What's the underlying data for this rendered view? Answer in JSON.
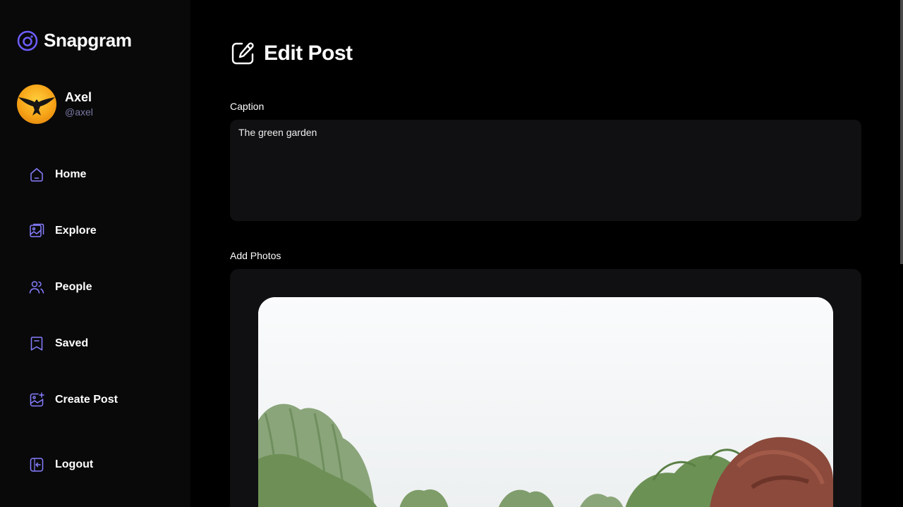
{
  "app": {
    "name": "Snapgram"
  },
  "user": {
    "name": "Axel",
    "handle": "@axel"
  },
  "nav": [
    {
      "label": "Home",
      "icon": "home-icon"
    },
    {
      "label": "Explore",
      "icon": "explore-icon"
    },
    {
      "label": "People",
      "icon": "people-icon"
    },
    {
      "label": "Saved",
      "icon": "bookmark-icon"
    },
    {
      "label": "Create Post",
      "icon": "create-post-icon"
    }
  ],
  "logout": {
    "label": "Logout",
    "icon": "logout-icon"
  },
  "page": {
    "title": "Edit Post",
    "caption_label": "Caption",
    "caption_value": "The green garden",
    "photos_label": "Add Photos"
  },
  "colors": {
    "accent": "#877eff",
    "sidebar_bg": "#09090a",
    "field_bg": "#101012",
    "muted": "#7878a3"
  }
}
